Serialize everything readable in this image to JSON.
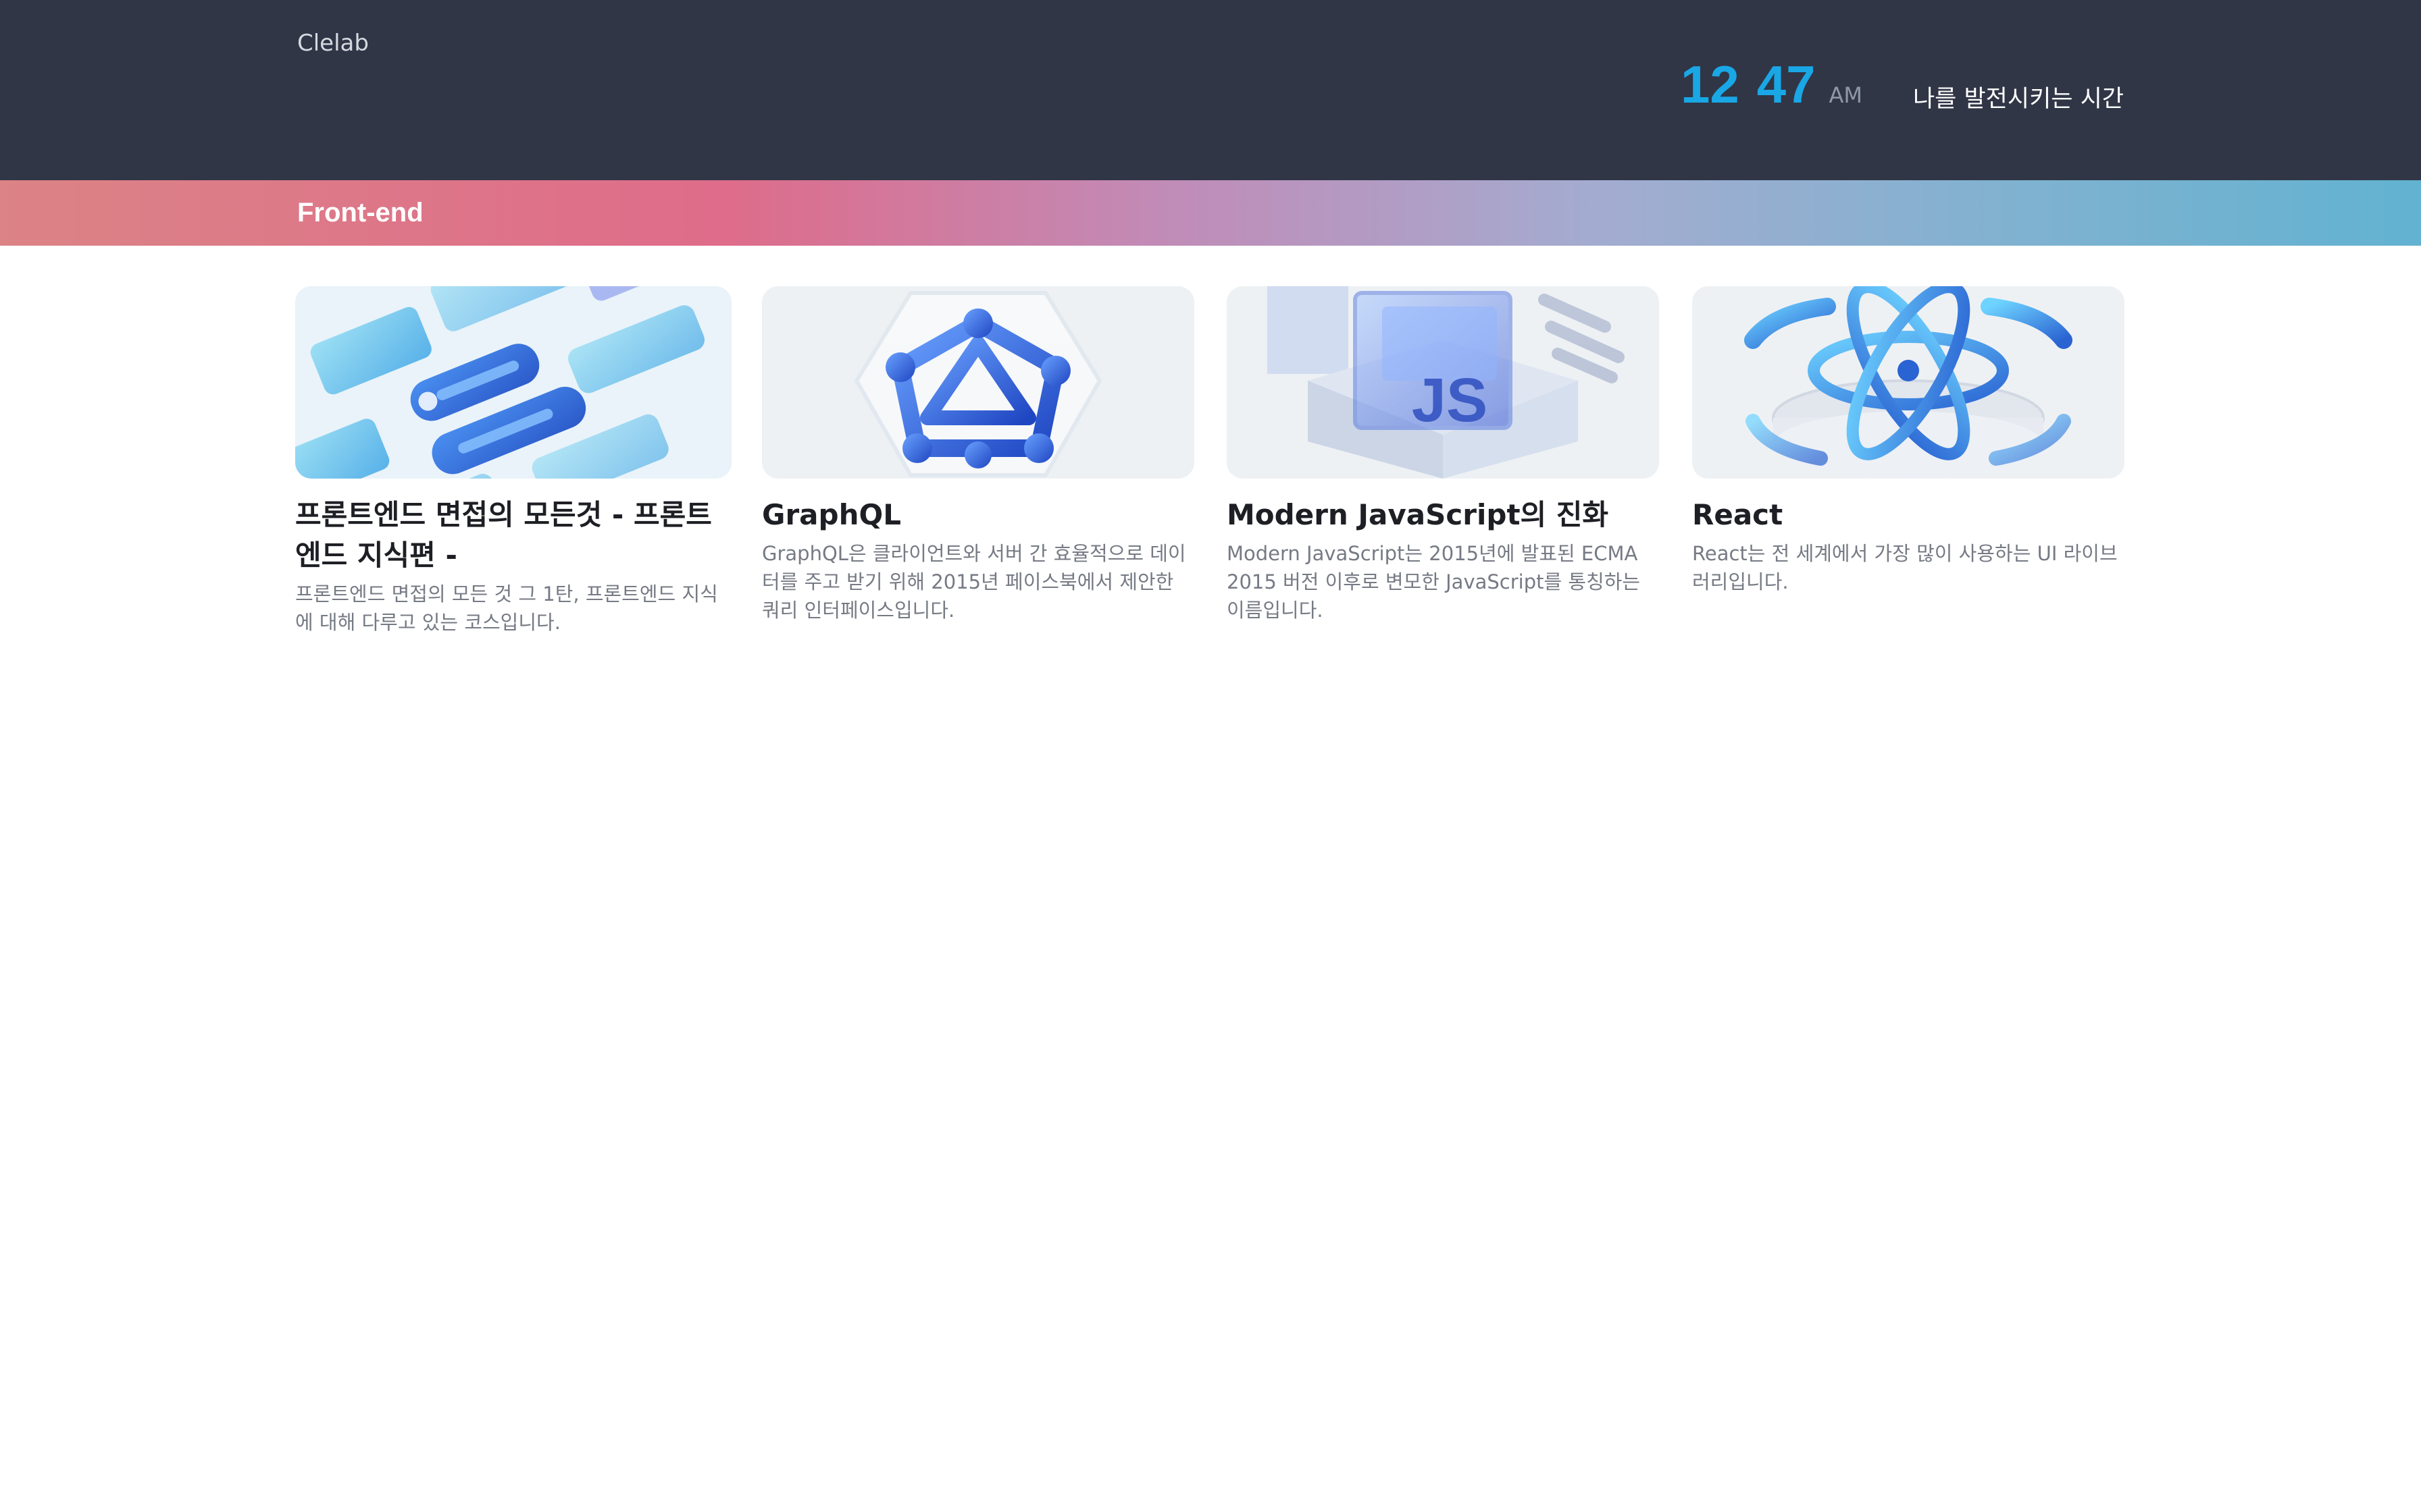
{
  "header": {
    "logo": "Clelab",
    "clock": {
      "hour": "12",
      "minute": "47",
      "ampm": "AM"
    },
    "tagline": "나를 발전시키는 시간"
  },
  "category": {
    "title": "Front-end"
  },
  "courses": [
    {
      "title": "프론트엔드 면접의 모든것 - 프론트엔드 지식편 -",
      "description": "프론트엔드 면접의 모든 것 그 1탄, 프론트엔드 지식에 대해 다루고 있는 코스입니다.",
      "thumbnail_icon": "ui-cards-illustration"
    },
    {
      "title": "GraphQL",
      "description": "GraphQL은 클라이언트와 서버 간 효율적으로 데이터를 주고 받기 위해 2015년 페이스북에서 제안한 쿼리 인터페이스입니다.",
      "thumbnail_icon": "graphql-logo-illustration"
    },
    {
      "title": "Modern JavaScript의 진화",
      "description": "Modern JavaScript는 2015년에 발표된 ECMA 2015 버전 이후로 변모한 JavaScript를 통칭하는 이름입니다.",
      "thumbnail_icon": "javascript-cube-illustration"
    },
    {
      "title": "React",
      "description": "React는 전 세계에서 가장 많이 사용하는 UI 라이브러리입니다.",
      "thumbnail_icon": "react-atom-illustration"
    }
  ],
  "colors": {
    "header_bg": "#303646",
    "clock": "#19a7e6",
    "gradient": [
      "#dc8386",
      "#de6c8a",
      "#c18bb7",
      "#a3acd0",
      "#62b2d1"
    ]
  }
}
